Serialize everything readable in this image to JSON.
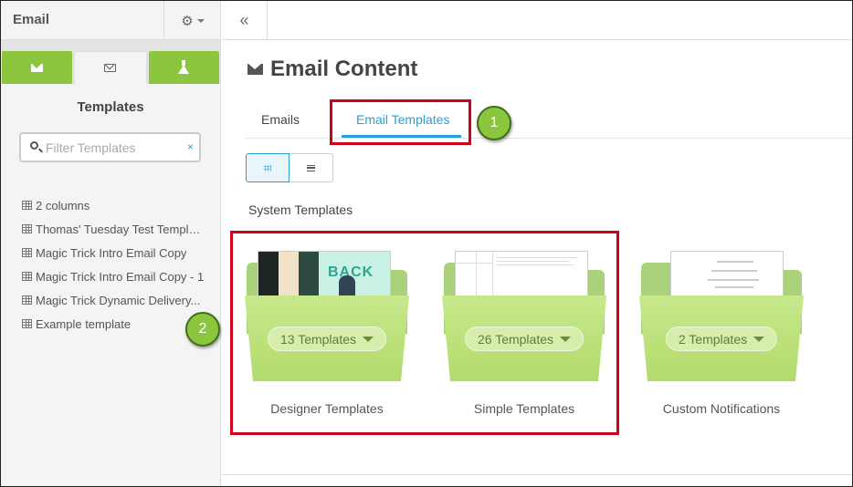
{
  "sidebar": {
    "title": "Email",
    "heading": "Templates",
    "search": {
      "placeholder": "Filter Templates",
      "clear_label": "×"
    },
    "templates": [
      "2 columns",
      "Thomas' Tuesday Test Template",
      "Magic Trick Intro Email Copy",
      "Magic Trick Intro Email Copy - 1",
      "Magic Trick Dynamic Delivery...",
      "Example template"
    ]
  },
  "topbar": {
    "collapse_label": "«"
  },
  "main": {
    "title": "Email Content",
    "tabs": [
      {
        "label": "Emails",
        "active": false
      },
      {
        "label": "Email Templates",
        "active": true
      }
    ],
    "section_label": "System Templates",
    "folders": [
      {
        "name": "Designer Templates",
        "count_label": "13 Templates"
      },
      {
        "name": "Simple Templates",
        "count_label": "26 Templates"
      },
      {
        "name": "Custom Notifications",
        "count_label": "2 Templates"
      }
    ],
    "preview_text": {
      "designer": "BACK"
    }
  },
  "annotations": {
    "badge_1": "1",
    "badge_2": "2"
  },
  "colors": {
    "accent": "#2a9fd6",
    "green": "#8cc63f",
    "annotation_red": "#d0021b"
  }
}
